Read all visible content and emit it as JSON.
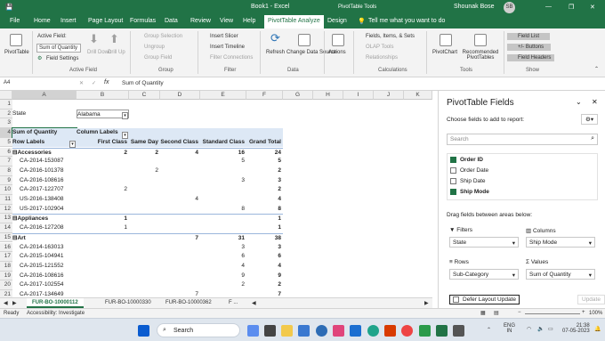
{
  "window": {
    "title": "Book1 - Excel",
    "context": "PivotTable Tools",
    "user": "Shounak Bose",
    "initials": "SB"
  },
  "tabs": [
    "File",
    "Home",
    "Insert",
    "Page Layout",
    "Formulas",
    "Data",
    "Review",
    "View",
    "Help",
    "PivotTable Analyze",
    "Design"
  ],
  "tell_me": "Tell me what you want to do",
  "ribbon": {
    "pivottable": "PivotTable",
    "active_field_label": "Active Field:",
    "active_field_value": "Sum of Quantity",
    "field_settings": "Field Settings",
    "drill_down": "Drill Down",
    "drill_up": "Drill Up",
    "group_selection": "Group Selection",
    "ungroup": "Ungroup",
    "group_field": "Group Field",
    "insert_slicer": "Insert Slicer",
    "insert_timeline": "Insert Timeline",
    "filter_connections": "Filter Connections",
    "refresh": "Refresh",
    "change_data_source": "Change Data Source",
    "actions": "Actions",
    "fields_items_sets": "Fields, Items, & Sets",
    "olap_tools": "OLAP Tools",
    "relationships": "Relationships",
    "pivotchart": "PivotChart",
    "recommended_pivottables": "Recommended PivotTables",
    "field_list": "Field List",
    "buttons": "+/- Buttons",
    "field_headers": "Field Headers",
    "groups": [
      "Active Field",
      "Group",
      "Filter",
      "Data",
      "Calculations",
      "Tools",
      "Show"
    ]
  },
  "formula_bar": {
    "name_box": "A4",
    "fx": "fx",
    "content": "Sum of Quantity"
  },
  "columns": [
    "A",
    "B",
    "C",
    "D",
    "E",
    "F",
    "G",
    "H",
    "I",
    "J",
    "K"
  ],
  "rows": [
    [
      "1",
      "",
      "",
      "",
      "",
      "",
      ""
    ],
    [
      "2",
      "State",
      "Alabama",
      "",
      "",
      "",
      ""
    ],
    [
      "3",
      "",
      "",
      "",
      "",
      "",
      ""
    ],
    [
      "4",
      "Sum of Quantity",
      "Column Labels",
      "",
      "",
      "",
      ""
    ],
    [
      "5",
      "Row Labels",
      "First Class",
      "Same Day",
      "Second Class",
      "Standard Class",
      "Grand Total"
    ],
    [
      "6",
      "⊟Accessories",
      "2",
      "2",
      "4",
      "16",
      "24"
    ],
    [
      "7",
      "CA-2014-153087",
      "",
      "",
      "",
      "5",
      "5"
    ],
    [
      "8",
      "CA-2016-101378",
      "",
      "2",
      "",
      "",
      "2"
    ],
    [
      "9",
      "CA-2016-108616",
      "",
      "",
      "",
      "3",
      "3"
    ],
    [
      "10",
      "CA-2017-122707",
      "2",
      "",
      "",
      "",
      "2"
    ],
    [
      "11",
      "US-2016-138408",
      "",
      "",
      "4",
      "",
      "4"
    ],
    [
      "12",
      "US-2017-102904",
      "",
      "",
      "",
      "8",
      "8"
    ],
    [
      "13",
      "⊟Appliances",
      "1",
      "",
      "",
      "",
      "1"
    ],
    [
      "14",
      "CA-2016-127208",
      "1",
      "",
      "",
      "",
      "1"
    ],
    [
      "15",
      "⊟Art",
      "",
      "",
      "7",
      "31",
      "38"
    ],
    [
      "16",
      "CA-2014-163013",
      "",
      "",
      "",
      "3",
      "3"
    ],
    [
      "17",
      "CA-2015-104941",
      "",
      "",
      "",
      "6",
      "6"
    ],
    [
      "18",
      "CA-2015-121552",
      "",
      "",
      "",
      "4",
      "4"
    ],
    [
      "19",
      "CA-2016-108616",
      "",
      "",
      "",
      "9",
      "9"
    ],
    [
      "20",
      "CA-2017-102554",
      "",
      "",
      "",
      "2",
      "2"
    ],
    [
      "21",
      "CA-2017-134649",
      "",
      "",
      "7",
      "",
      "7"
    ]
  ],
  "sheet_tabs": [
    "FUR-BO-10000112",
    "FUR-BO-10000330",
    "FUR-BO-10000362",
    "F ..."
  ],
  "status": {
    "ready": "Ready",
    "accessibility": "Accessibility: Investigate",
    "zoom": "100%"
  },
  "pane": {
    "title": "PivotTable Fields",
    "subtitle": "Choose fields to add to report:",
    "search_placeholder": "Search",
    "fields": [
      {
        "name": "Order ID",
        "checked": true
      },
      {
        "name": "Order Date",
        "checked": false
      },
      {
        "name": "Ship Date",
        "checked": false
      },
      {
        "name": "Ship Mode",
        "checked": true
      }
    ],
    "drag_label": "Drag fields between areas below:",
    "filters_label": "Filters",
    "columns_label": "Columns",
    "rows_label": "Rows",
    "values_label": "Values",
    "filters_value": "State",
    "columns_value": "Ship Mode",
    "rows_value": "Sub-Category",
    "values_value": "Sum of Quantity",
    "defer": "Defer Layout Update",
    "update": "Update"
  },
  "taskbar": {
    "search": "Search",
    "lang1": "ENG",
    "lang2": "IN",
    "time": "21:38",
    "date": "07-05-2023"
  }
}
